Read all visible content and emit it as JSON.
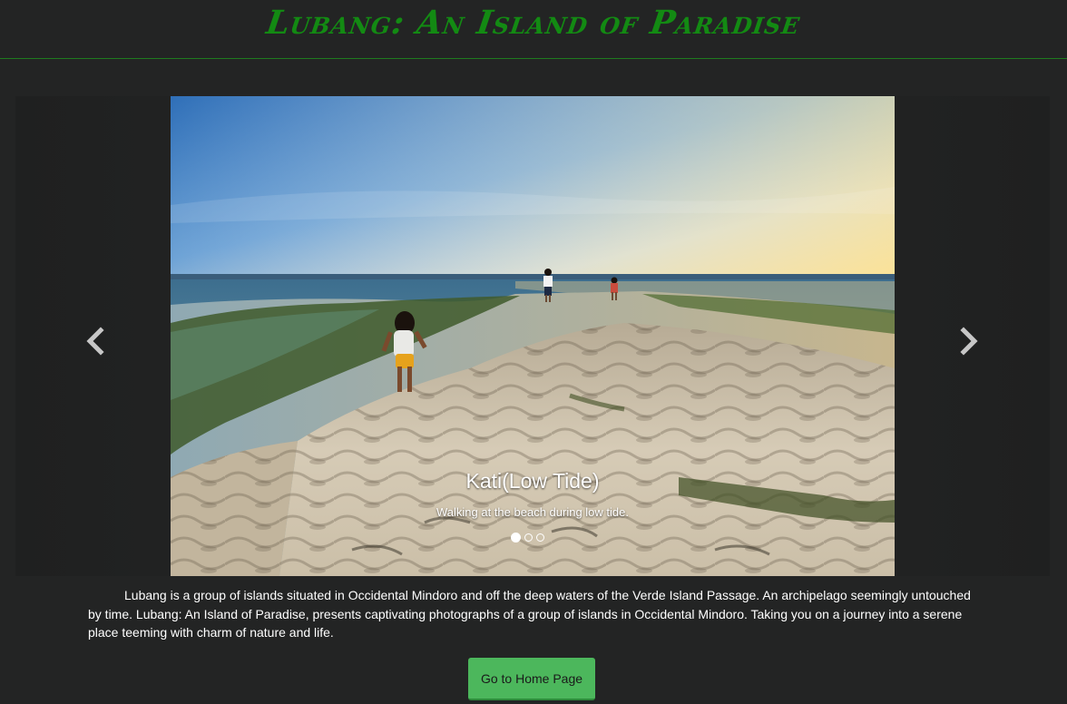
{
  "header": {
    "title": "Lubang: An Island of Paradise"
  },
  "carousel": {
    "slides": [
      {
        "title": "Kati(Low Tide)",
        "subtitle": "Walking at the beach during low tide."
      }
    ],
    "active_index": 0,
    "indicator_count": 3,
    "prev_icon": "chevron-left-icon",
    "next_icon": "chevron-right-icon"
  },
  "main": {
    "description": "Lubang is a group of islands situated in Occidental Mindoro and off the deep waters of the Verde Island Passage. An archipelago seemingly untouched by time. Lubang: An Island of Paradise, presents captivating photographs of a group of islands in Occidental Mindoro. Taking you on a journey into a serene place teeming with charm of nature and life.",
    "home_button_label": "Go to Home Page"
  },
  "colors": {
    "background": "#232424",
    "title": "#138a13",
    "divider": "#1f7a1f",
    "button": "#4cb75c"
  }
}
